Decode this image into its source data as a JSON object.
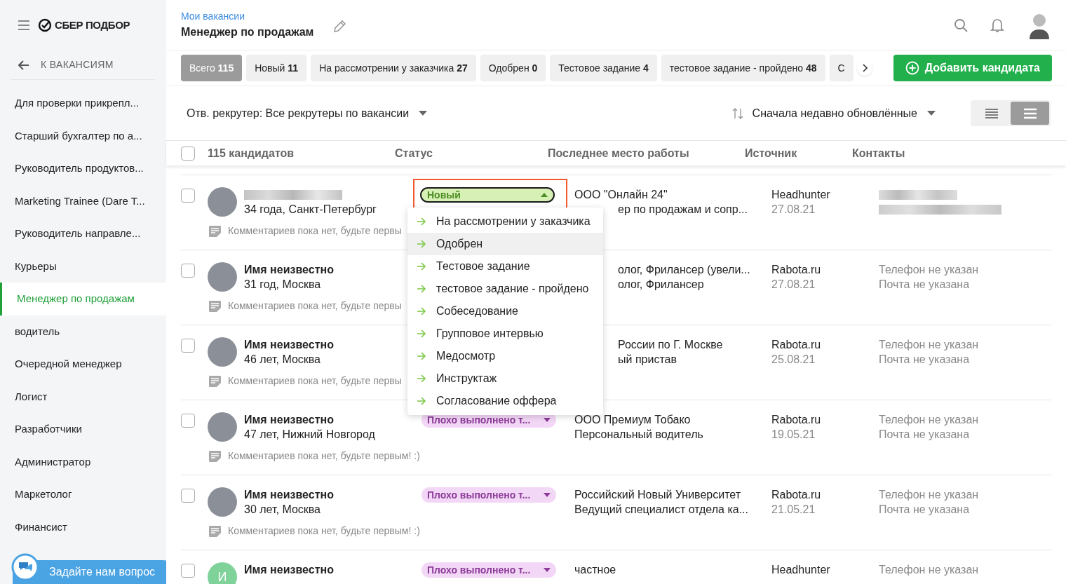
{
  "sidebar": {
    "logo": "СБЕР ПОДБОР",
    "back": "К ВАКАНСИЯМ",
    "items": [
      {
        "label": "Для проверки прикрепл...",
        "selected": false
      },
      {
        "label": "Старший бухгалтер по а...",
        "selected": false
      },
      {
        "label": "Руководитель продуктов...",
        "selected": false
      },
      {
        "label": "Marketing Trainee (Dare T...",
        "selected": false
      },
      {
        "label": "Руководитель направле...",
        "selected": false
      },
      {
        "label": "Курьеры",
        "selected": false
      },
      {
        "label": "Менеджер по продажам",
        "selected": true
      },
      {
        "label": "водитель",
        "selected": false
      },
      {
        "label": "Очередной менеджер",
        "selected": false
      },
      {
        "label": "Логист",
        "selected": false
      },
      {
        "label": "Разработчики",
        "selected": false
      },
      {
        "label": "Администратор",
        "selected": false
      },
      {
        "label": "Маркетолог",
        "selected": false
      },
      {
        "label": "Финансист",
        "selected": false
      }
    ],
    "chat": "Задайте нам вопрос"
  },
  "header": {
    "breadcrumb": "Мои вакансии",
    "title": "Менеджер по продажам"
  },
  "tabs": [
    {
      "label": "Всего",
      "count": "115",
      "selected": true
    },
    {
      "label": "Новый",
      "count": "11",
      "selected": false
    },
    {
      "label": "На рассмотрении у заказчика",
      "count": "27",
      "selected": false
    },
    {
      "label": "Одобрен",
      "count": "0",
      "selected": false
    },
    {
      "label": "Тестовое задание",
      "count": "4",
      "selected": false
    },
    {
      "label": "тестовое задание - пройдено",
      "count": "48",
      "selected": false
    },
    {
      "label": "С",
      "selected": false
    }
  ],
  "add_button": "Добавить кандидата",
  "filters": {
    "recruiter": "Отв. рекрутер: Все рекрутеры по вакансии",
    "sort": "Сначала недавно обновлённые",
    "views": [
      {
        "kind": "compact",
        "selected": false
      },
      {
        "kind": "wide",
        "selected": true
      }
    ]
  },
  "table": {
    "all_checked": false,
    "columns": [
      "115 кандидатов",
      "Статус",
      "Последнее место работы",
      "Источник",
      "Контакты"
    ],
    "rows": [
      {
        "checked": false,
        "kind": "photo",
        "details": "34 года, Санкт-Петербург",
        "comment": "Комментариев пока нет, будьте первы",
        "status": {
          "label": "Новый",
          "kind": "new",
          "open": true
        },
        "work": [
          "ООО \"Онлайн 24\"",
          "ер по продажам и сопр..."
        ],
        "source": "Headhunter",
        "date": "27.08.21"
      },
      {
        "checked": false,
        "kind": "photo",
        "name": "Имя неизвестно",
        "details": "31 год, Москва",
        "comment": "Комментариев пока нет, будьте первы",
        "work": [
          "олог, Фрилансер (увели...",
          "олог, Фрилансер"
        ],
        "source": "Rabota.ru",
        "date": "27.08.21",
        "contacts": [
          "Телефон не указан",
          "Почта не указана"
        ]
      },
      {
        "checked": false,
        "kind": "photo",
        "name": "Имя неизвестно",
        "details": "46 лет, Москва",
        "comment": "Комментариев пока нет, будьте первы",
        "work": [
          "России по Г. Москве",
          "ый пристав"
        ],
        "source": "Rabota.ru",
        "date": "25.08.21",
        "contacts": [
          "Телефон не указан",
          "Почта не указана"
        ]
      },
      {
        "checked": false,
        "kind": "photo",
        "name": "Имя неизвестно",
        "details": "47 лет, Нижний Новгород",
        "comment": "Комментариев пока нет, будьте первым! :)",
        "status": {
          "label": "Плохо выполнено т...",
          "kind": "bad",
          "open": false
        },
        "work": [
          "ООО Премиум Тобако",
          "Персональный водитель"
        ],
        "source": "Rabota.ru",
        "date": "19.05.21",
        "contacts": [
          "Телефон не указан",
          "Почта не указана"
        ]
      },
      {
        "checked": false,
        "kind": "photo",
        "name": "Имя неизвестно",
        "details": "30 лет, Москва",
        "comment": "Комментариев пока нет, будьте первым! :)",
        "status": {
          "label": "Плохо выполнено т...",
          "kind": "bad",
          "open": false
        },
        "work": [
          "Российский Новый Университет",
          "Ведущий специалист отдела ка..."
        ],
        "source": "Rabota.ru",
        "date": "21.05.21",
        "contacts": [
          "Телефон не указан",
          "Почта не указана"
        ]
      },
      {
        "checked": false,
        "kind": "initial",
        "initial": "И",
        "name": "Имя неизвестно",
        "status": {
          "label": "Плохо выполнено т...",
          "kind": "bad",
          "open": false
        },
        "work": [
          "частное"
        ],
        "source": "Headhunter",
        "contacts": [
          "Телефон не указан"
        ]
      }
    ]
  },
  "status_menu": [
    {
      "label": "На рассмотрении у заказчика",
      "selected": false
    },
    {
      "label": "Одобрен",
      "selected": true
    },
    {
      "label": "Тестовое задание",
      "selected": false
    },
    {
      "label": "тестовое задание - пройдено",
      "selected": false
    },
    {
      "label": "Собеседование",
      "selected": false
    },
    {
      "label": "Групповое интервью",
      "selected": false
    },
    {
      "label": "Медосмотр",
      "selected": false
    },
    {
      "label": "Инструктаж",
      "selected": false
    },
    {
      "label": "Согласование оффера",
      "selected": false
    }
  ]
}
